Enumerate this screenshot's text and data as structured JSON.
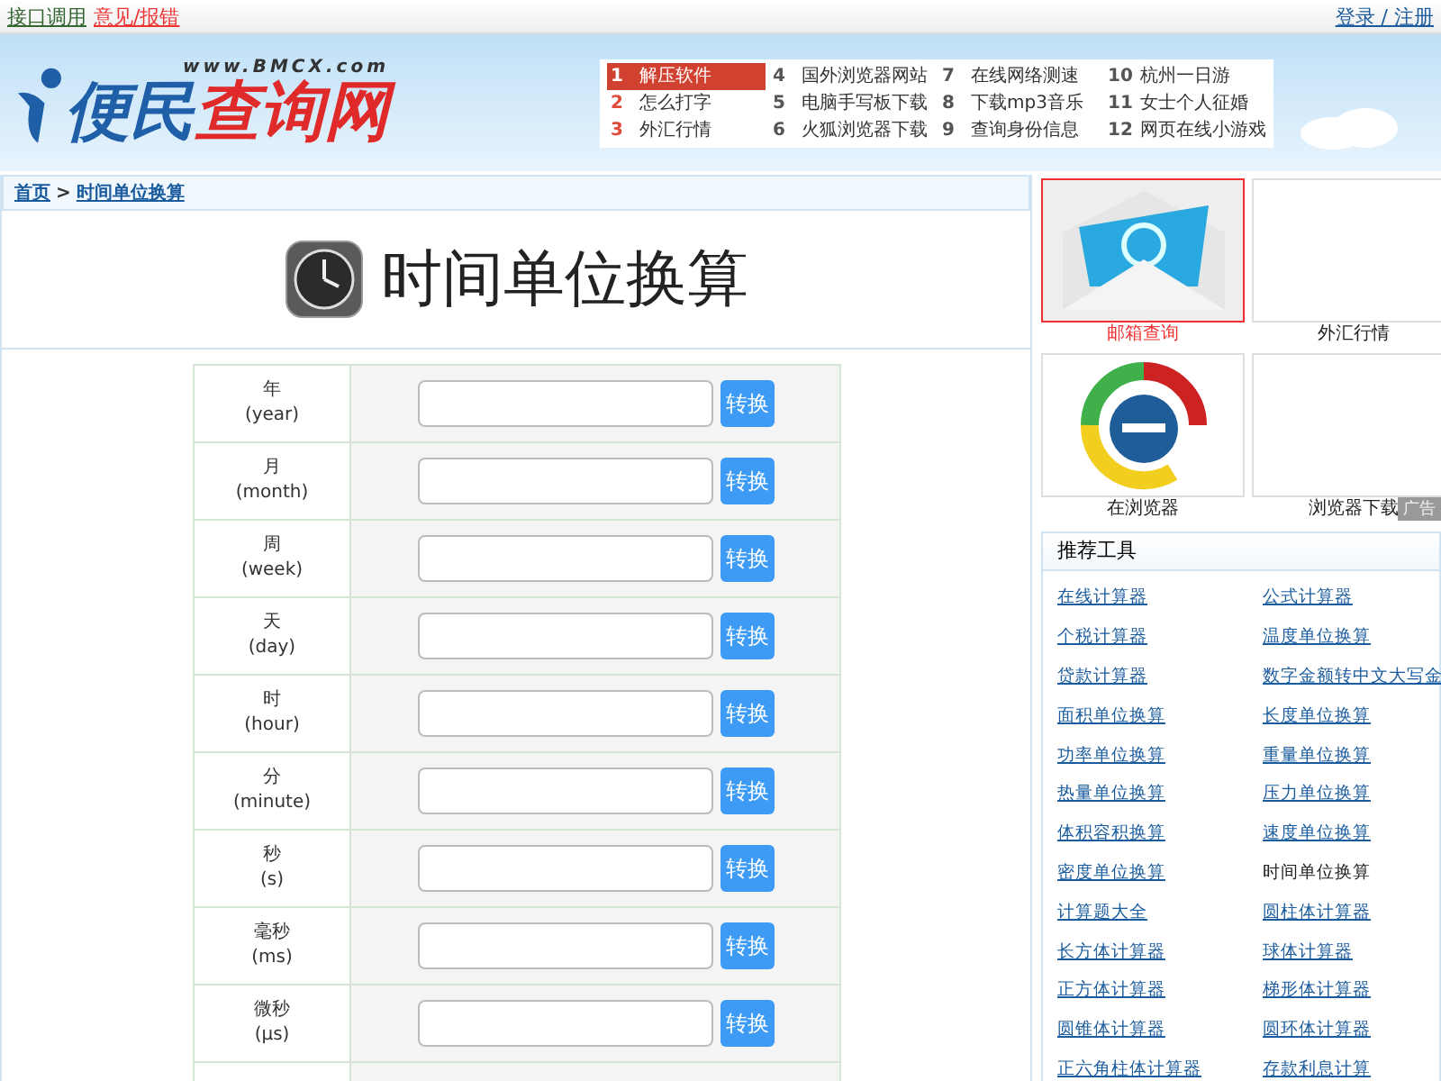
{
  "top_links": [
    {
      "label": "接口调用",
      "color": "#336633"
    },
    {
      "label": "意见/报错",
      "color": "#ee3333"
    }
  ],
  "account_links": [
    "登录 / 注册"
  ],
  "logo": {
    "name_parts": [
      "便民",
      "查询网"
    ],
    "domain": "www.BMCX.com"
  },
  "hot_list": [
    {
      "rank": "1",
      "label": "解压软件",
      "selected": true
    },
    {
      "rank": "2",
      "label": "怎么打字",
      "selected": false
    },
    {
      "rank": "3",
      "label": "外汇行情",
      "selected": false
    },
    {
      "rank": "4",
      "label": "国外浏览器网站",
      "selected": false
    },
    {
      "rank": "5",
      "label": "电脑手写板下载",
      "selected": false
    },
    {
      "rank": "6",
      "label": "火狐浏览器下载",
      "selected": false
    },
    {
      "rank": "7",
      "label": "在线网络测速",
      "selected": false
    },
    {
      "rank": "8",
      "label": "下载mp3音乐",
      "selected": false
    },
    {
      "rank": "9",
      "label": "查询身份信息",
      "selected": false
    },
    {
      "rank": "10",
      "label": "杭州一日游",
      "selected": false
    },
    {
      "rank": "11",
      "label": "女士个人征婚",
      "selected": false
    },
    {
      "rank": "12",
      "label": "网页在线小游戏",
      "selected": false
    }
  ],
  "breadcrumb": [
    {
      "label": "首页"
    },
    {
      "label": "时间单位换算"
    }
  ],
  "breadcrumb_separator": ">",
  "page_title": "时间单位换算",
  "units": [
    {
      "name": "年",
      "code": "(year)",
      "button": "转换"
    },
    {
      "name": "月",
      "code": "(month)",
      "button": "转换"
    },
    {
      "name": "周",
      "code": "(week)",
      "button": "转换"
    },
    {
      "name": "天",
      "code": "(day)",
      "button": "转换"
    },
    {
      "name": "时",
      "code": "(hour)",
      "button": "转换"
    },
    {
      "name": "分",
      "code": "(minute)",
      "button": "转换"
    },
    {
      "name": "秒",
      "code": "(s)",
      "button": "转换"
    },
    {
      "name": "毫秒",
      "code": "(ms)",
      "button": "转换"
    },
    {
      "name": "微秒",
      "code": "(μs)",
      "button": "转换"
    }
  ],
  "tiles": [
    {
      "kind": "mail",
      "caption": "邮箱查询",
      "selected": true
    },
    {
      "kind": "blank",
      "caption": "外汇行情",
      "selected": false
    },
    {
      "kind": "browser",
      "caption": "在浏览器",
      "selected": false
    },
    {
      "kind": "blank",
      "caption": "浏览器下载",
      "selected": false
    }
  ],
  "ad_label": "广告",
  "tools": {
    "title": "推荐工具",
    "items": [
      {
        "label": "在线计算器",
        "current": false
      },
      {
        "label": "公式计算器",
        "current": false
      },
      {
        "label": "个税计算器",
        "current": false
      },
      {
        "label": "温度单位换算",
        "current": false
      },
      {
        "label": "贷款计算器",
        "current": false
      },
      {
        "label": "数字金额转中文大写金",
        "current": false
      },
      {
        "label": "面积单位换算",
        "current": false
      },
      {
        "label": "长度单位换算",
        "current": false
      },
      {
        "label": "功率单位换算",
        "current": false
      },
      {
        "label": "重量单位换算",
        "current": false
      },
      {
        "label": "热量单位换算",
        "current": false
      },
      {
        "label": "压力单位换算",
        "current": false
      },
      {
        "label": "体积容积换算",
        "current": false
      },
      {
        "label": "速度单位换算",
        "current": false
      },
      {
        "label": "密度单位换算",
        "current": false
      },
      {
        "label": "时间单位换算",
        "current": true
      },
      {
        "label": "计算题大全",
        "current": false
      },
      {
        "label": "圆柱体计算器",
        "current": false
      },
      {
        "label": "长方体计算器",
        "current": false
      },
      {
        "label": "球体计算器",
        "current": false
      },
      {
        "label": "正方体计算器",
        "current": false
      },
      {
        "label": "梯形体计算器",
        "current": false
      },
      {
        "label": "圆锥体计算器",
        "current": false
      },
      {
        "label": "圆环体计算器",
        "current": false
      },
      {
        "label": "正六角柱体计算器",
        "current": false
      },
      {
        "label": "存款利息计算",
        "current": false
      }
    ]
  }
}
